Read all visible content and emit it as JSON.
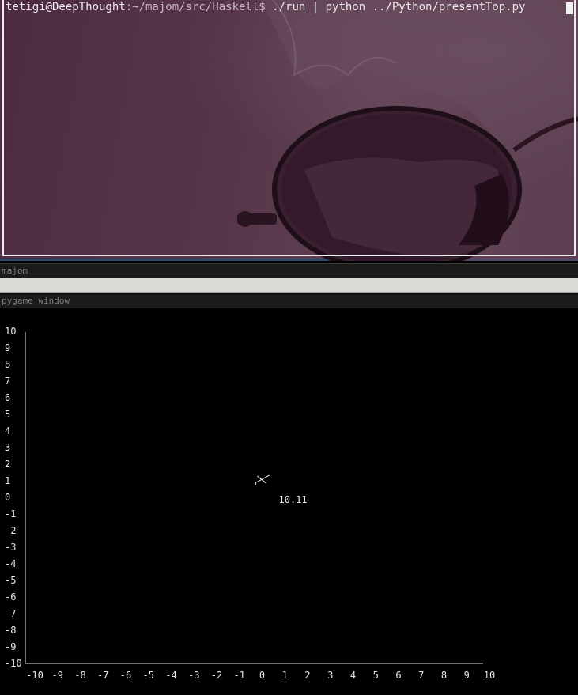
{
  "terminal": {
    "user_host": "tetigi@DeepThought",
    "path": ":~/majom/src/Haskell$",
    "command": " ./run | python ../Python/presentTop.py "
  },
  "windows": {
    "majom_title": "majom",
    "pygame_title": "pygame window"
  },
  "chart_data": {
    "type": "scatter",
    "xlim": [
      -10,
      10
    ],
    "ylim": [
      -10,
      10
    ],
    "x_ticks": [
      -10,
      -9,
      -8,
      -7,
      -6,
      -5,
      -4,
      -3,
      -2,
      -1,
      0,
      1,
      2,
      3,
      4,
      5,
      6,
      7,
      8,
      9,
      10
    ],
    "y_ticks": [
      10,
      9,
      8,
      7,
      6,
      5,
      4,
      3,
      2,
      1,
      0,
      -1,
      -2,
      -3,
      -4,
      -5,
      -6,
      -7,
      -8,
      -9,
      -10
    ],
    "grid": false,
    "points": [
      {
        "x": 0,
        "y": 1,
        "marker": "quadcopter",
        "label": "10.11"
      }
    ]
  }
}
